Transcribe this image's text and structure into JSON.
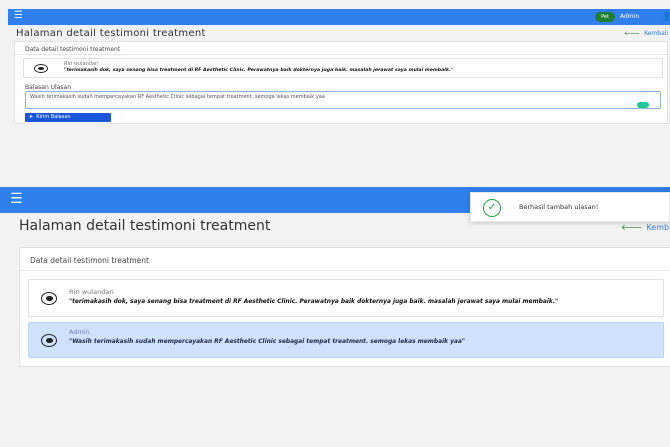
{
  "screen_before": {
    "topbar": {
      "menu_icon": "hamburger-icon",
      "badge_text": "Pet",
      "admin_label": "Admin",
      "user_icon": "user-icon"
    },
    "page_title": "Halaman detail testimoni treatment",
    "back_label": "Kembali",
    "card_header": "Data detail testimoni treatment",
    "user_message": {
      "name": "Riri wulandari",
      "text": "\"terimakasih dok, saya senang bisa treatment di RF Aesthetic Clinic. Perawatnya baik dokternya juga baik. masalah jerawat saya mulai membaik.\""
    },
    "reply_label": "Balasan Ulasan",
    "reply_value": "Wasih terimakasih sudah mempercayakan RF Aesthetic Clinic sebagai tempat treatment. semoga lekas membaik yaa",
    "send_button": "Kirim Balasan"
  },
  "screen_after": {
    "topbar": {
      "menu_icon": "hamburger-icon"
    },
    "page_title": "Halaman detail testimoni treatment",
    "back_label": "Kembali",
    "card_header": "Data detail testimoni treatment",
    "user_message": {
      "name": "Riri wulandari",
      "text": "\"terimakasih dok, saya senang bisa treatment di RF Aesthetic Clinic. Perawatnya baik dokternya juga baik. masalah jerawat saya mulai membaik.\""
    },
    "admin_message": {
      "name": "Admin",
      "text": "\"Wasih terimakasih sudah mempercayakan RF Aesthetic Clinic sebagai tempat treatment. semoga lekas membaik yaa\""
    },
    "toast": {
      "text": "Berhasil tambah ulasan!"
    }
  },
  "colors": {
    "primary": "#2f80ed",
    "success": "#2ea043",
    "admin_bubble": "#cfe2ff",
    "button": "#1a56db"
  }
}
